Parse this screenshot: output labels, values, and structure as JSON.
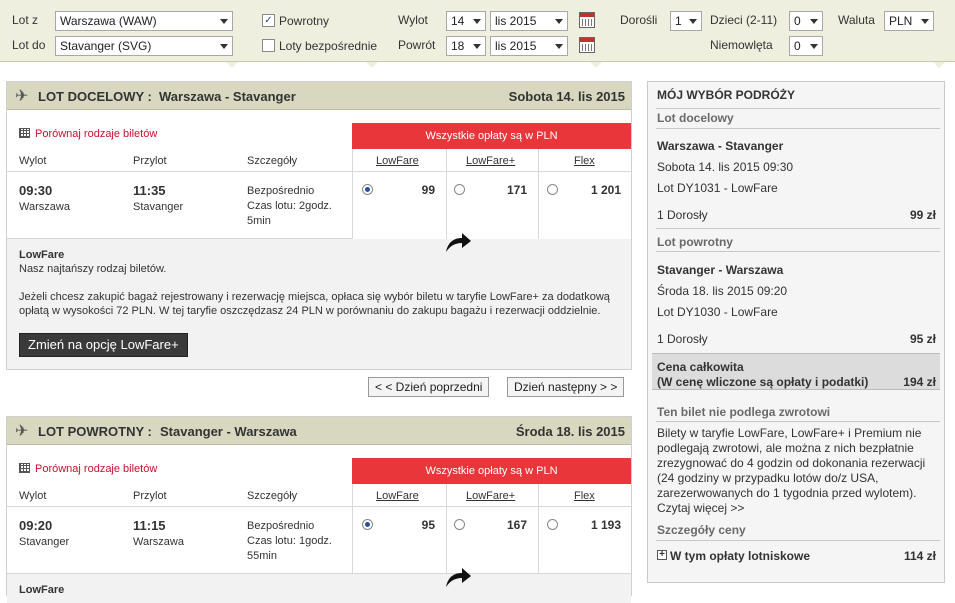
{
  "search": {
    "from_label": "Lot z",
    "from_value": "Warszawa (WAW)",
    "to_label": "Lot do",
    "to_value": "Stavanger (SVG)",
    "return_label": "Powrotny",
    "return_checked": true,
    "direct_label": "Loty bezpośrednie",
    "direct_checked": false,
    "depart_label": "Wylot",
    "depart_day": "14",
    "depart_month": "lis 2015",
    "return_date_label": "Powrót",
    "return_day": "18",
    "return_month": "lis 2015",
    "adults_label": "Dorośli",
    "adults_value": "1",
    "children_label": "Dzieci (2-11)",
    "children_value": "0",
    "infants_label": "Niemowlęta",
    "infants_value": "0",
    "currency_label": "Waluta",
    "currency_value": "PLN"
  },
  "outbound": {
    "title": "LOT DOCELOWY :",
    "route": "Warszawa - Stavanger",
    "date": "Sobota 14. lis 2015",
    "compare_link": "Porównaj rodzaje biletów",
    "fees_banner": "Wszystkie opłaty są w PLN",
    "col_depart": "Wylot",
    "col_arrive": "Przylot",
    "col_details": "Szczegóły",
    "fares": [
      "LowFare",
      "LowFare+",
      "Flex"
    ],
    "depart_time": "09:30",
    "depart_city": "Warszawa",
    "arrive_time": "11:35",
    "arrive_city": "Stavanger",
    "details_1": "Bezpośrednio",
    "details_2": "Czas lotu: 2godz.",
    "details_3": "5min",
    "prices": [
      "99",
      "171",
      "1 201"
    ],
    "selected_fare": 0,
    "info_title": "LowFare",
    "info_sub": "Nasz najtańszy rodzaj biletów.",
    "info_body_1": "Jeżeli chcesz zakupić bagaż rejestrowany i rezerwację miejsca, opłaca się wybór biletu w taryfie LowFare+ za dodatkową",
    "info_body_2": "opłatą w wysokości 72 PLN. W tej taryfie oszczędzasz 24 PLN w porównaniu do zakupu bagażu i rezerwacji oddzielnie.",
    "upgrade_button": "Zmień na opcję LowFare+"
  },
  "day_nav": {
    "prev": "< < Dzień poprzedni",
    "next": "Dzień następny > >"
  },
  "inbound": {
    "title": "LOT POWROTNY :",
    "route": "Stavanger - Warszawa",
    "date": "Środa 18. lis 2015",
    "compare_link": "Porównaj rodzaje biletów",
    "fees_banner": "Wszystkie opłaty są w PLN",
    "col_depart": "Wylot",
    "col_arrive": "Przylot",
    "col_details": "Szczegóły",
    "fares": [
      "LowFare",
      "LowFare+",
      "Flex"
    ],
    "depart_time": "09:20",
    "depart_city": "Stavanger",
    "arrive_time": "11:15",
    "arrive_city": "Warszawa",
    "details_1": "Bezpośrednio",
    "details_2": "Czas lotu: 1godz.",
    "details_3": "55min",
    "prices": [
      "95",
      "167",
      "1 193"
    ],
    "selected_fare": 0,
    "info_title": "LowFare"
  },
  "summary": {
    "title": "MÓJ WYBÓR PODRÓŻY",
    "outbound_header": "Lot docelowy",
    "outbound_route": "Warszawa - Stavanger",
    "outbound_datetime": "Sobota 14. lis 2015 09:30",
    "outbound_flight": "Lot DY1031 - LowFare",
    "outbound_pax": "1 Dorosły",
    "outbound_price": "99 zł",
    "return_header": "Lot powrotny",
    "return_route": "Stavanger - Warszawa",
    "return_datetime": "Środa 18. lis 2015 09:20",
    "return_flight": "Lot DY1030 - LowFare",
    "return_pax": "1 Dorosły",
    "return_price": "95 zł",
    "total_label": "Cena całkowita",
    "total_note": "(W cenę wliczone są opłaty i podatki)",
    "total_price": "194 zł",
    "refund_header": "Ten bilet nie podlega zwrotowi",
    "refund_l1": "Bilety w taryfie LowFare, LowFare+ i Premium nie",
    "refund_l2": "podlegają zwrotowi, ale można z nich bezpłatnie",
    "refund_l3": "zrezygnować do 4 godzin od dokonania rezerwacji",
    "refund_l4": "(24 godziny w przypadku lotów do/z USA,",
    "refund_l5": "zarezerwowanych do 1 tygodnia przed wylotem).",
    "read_more": "Czytaj więcej >>",
    "price_details_header": "Szczegóły ceny",
    "airport_fees_label": "W tym opłaty lotniskowe",
    "airport_fees_value": "114 zł"
  },
  "icons": {
    "plane": "plane-icon",
    "calendar": "calendar-icon",
    "grid": "grid-icon",
    "arrow": "curved-arrow-icon",
    "expand": "plus-box-icon"
  },
  "colors": {
    "accent_red": "#e8363b",
    "header_bg": "#d8d8c0",
    "search_bg": "#efefdf"
  }
}
